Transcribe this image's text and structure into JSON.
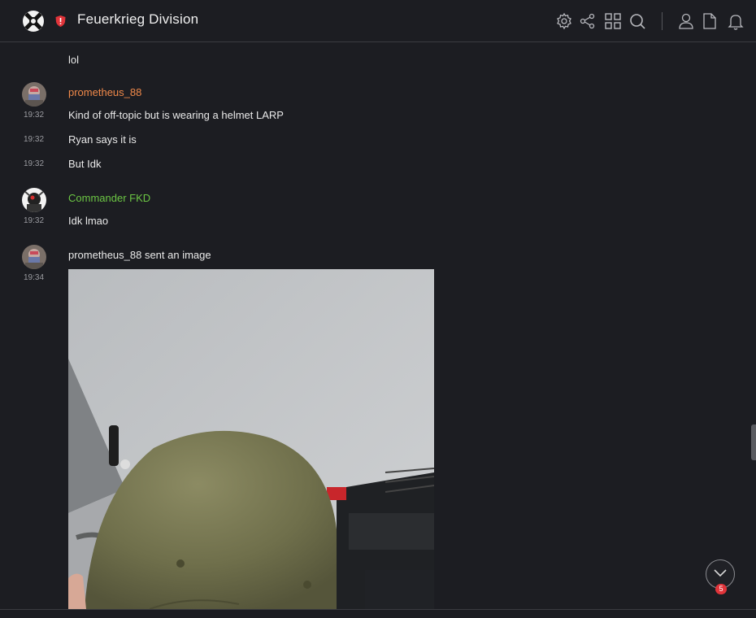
{
  "header": {
    "server_name": "Feuerkrieg Division",
    "icons": [
      "settings-icon",
      "share-icon",
      "apps-grid-icon",
      "search-icon",
      "members-icon",
      "files-icon",
      "notifications-icon"
    ]
  },
  "messages": [
    {
      "text": "lol"
    },
    {
      "author": "prometheus_88",
      "author_color": "#f0894a",
      "time": "19:32",
      "text": "Kind of off-topic but is wearing a helmet LARP"
    },
    {
      "time": "19:32",
      "text": "Ryan says it is"
    },
    {
      "time": "19:32",
      "text": "But Idk"
    },
    {
      "author": "Commander FKD",
      "author_color": "#6cc644",
      "time": "19:32",
      "text": "Idk lmao"
    },
    {
      "time": "19:34",
      "text": "prometheus_88 sent an image"
    }
  ],
  "jump_to_latest": {
    "unread_count": "5"
  },
  "colors": {
    "background": "#1c1d22",
    "badge": "#e0343a"
  }
}
